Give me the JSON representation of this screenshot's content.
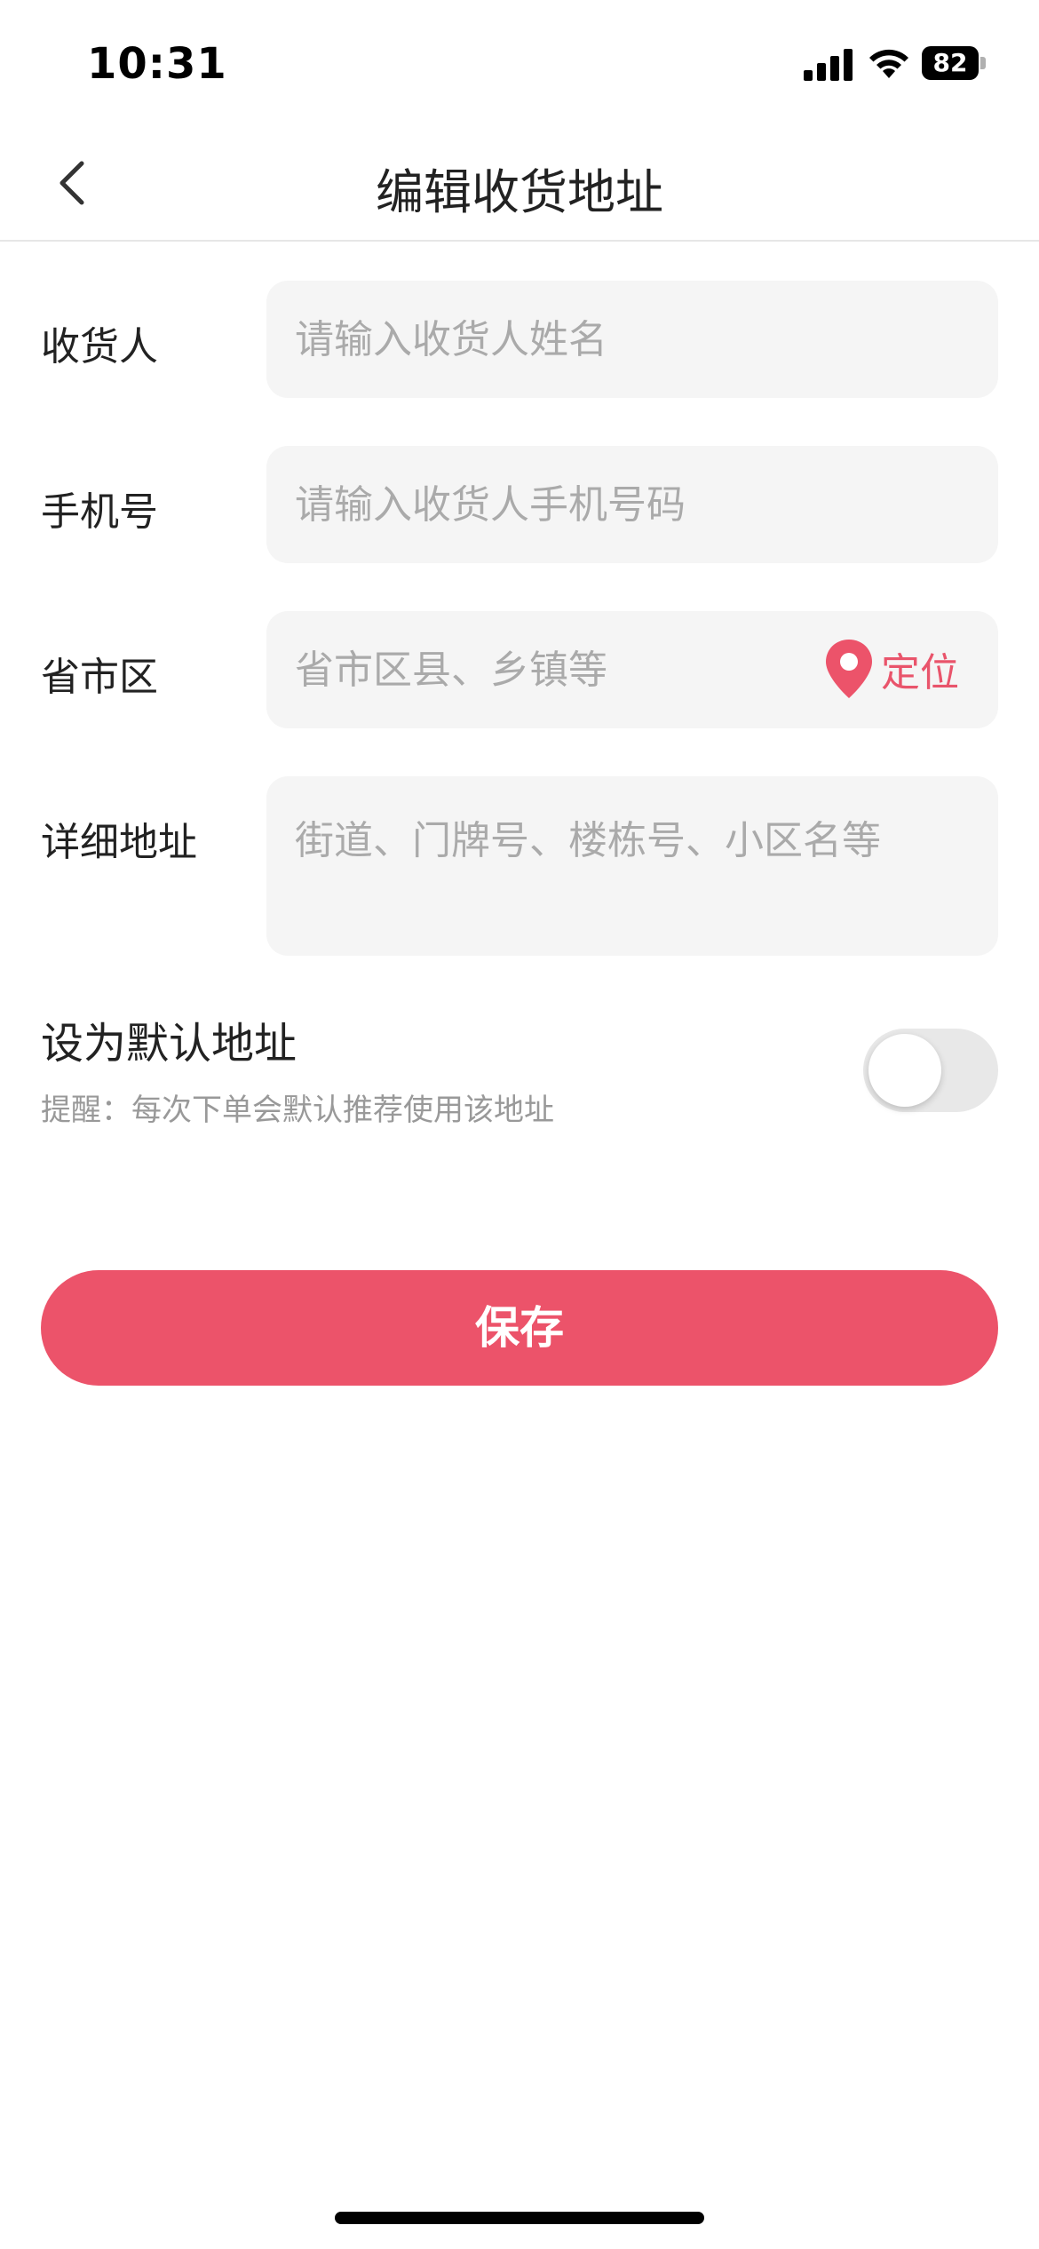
{
  "status_bar": {
    "time": "10:31",
    "battery": "82"
  },
  "nav": {
    "title": "编辑收货地址",
    "back_icon": "chevron-left-icon"
  },
  "form": {
    "recipient": {
      "label": "收货人",
      "placeholder": "请输入收货人姓名",
      "value": ""
    },
    "phone": {
      "label": "手机号",
      "placeholder": "请输入收货人手机号码",
      "value": ""
    },
    "region": {
      "label": "省市区",
      "placeholder": "省市区县、乡镇等",
      "value": "",
      "locate_label": "定位",
      "locate_icon": "location-pin-icon"
    },
    "detail": {
      "label": "详细地址",
      "placeholder": "街道、门牌号、楼栋号、小区名等",
      "value": ""
    }
  },
  "default_address": {
    "title": "设为默认地址",
    "hint": "提醒：每次下单会默认推荐使用该地址",
    "enabled": false
  },
  "save_label": "保存",
  "colors": {
    "accent": "#ec536a",
    "field_bg": "#f5f5f5",
    "placeholder": "#aaaaaa"
  }
}
